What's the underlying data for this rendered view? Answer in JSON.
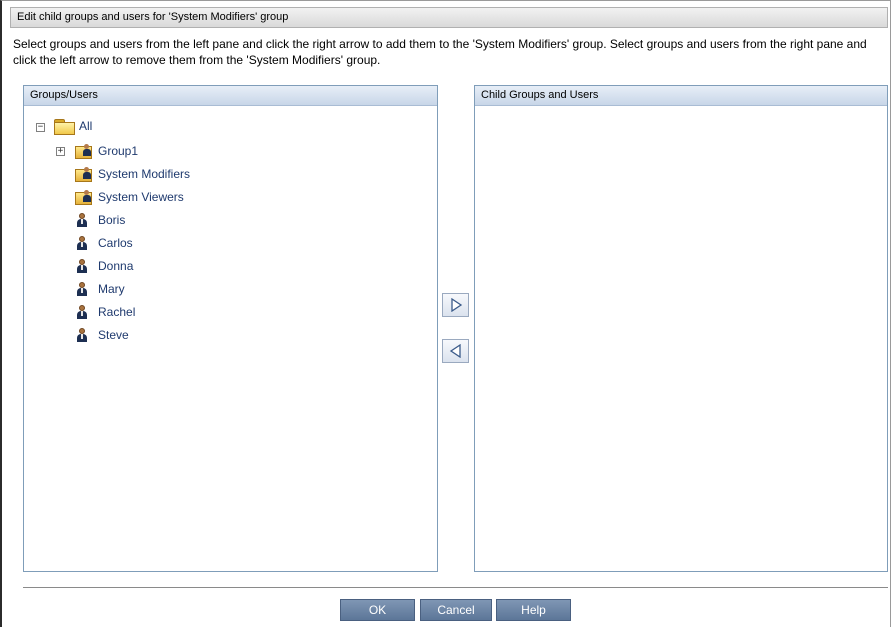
{
  "dialog": {
    "title": "Edit child groups and users for 'System Modifiers' group",
    "instructions": "Select groups and users from the left pane and click the right arrow to add them to the 'System Modifiers' group. Select groups and users from the right pane and click the left arrow to remove them from the 'System Modifiers' group."
  },
  "left_pane": {
    "header": "Groups/Users",
    "tree": {
      "root": {
        "label": "All",
        "expander": "−",
        "icon": "folder-icon"
      },
      "groups": [
        {
          "label": "Group1",
          "expander": "+",
          "icon": "group-folder-icon"
        },
        {
          "label": "System Modifiers",
          "icon": "group-folder-icon"
        },
        {
          "label": "System Viewers",
          "icon": "group-folder-icon"
        }
      ],
      "users": [
        {
          "label": "Boris",
          "icon": "user-icon"
        },
        {
          "label": "Carlos",
          "icon": "user-icon"
        },
        {
          "label": "Donna",
          "icon": "user-icon"
        },
        {
          "label": "Mary",
          "icon": "user-icon"
        },
        {
          "label": "Rachel",
          "icon": "user-icon"
        },
        {
          "label": "Steve",
          "icon": "user-icon"
        }
      ]
    }
  },
  "right_pane": {
    "header": "Child Groups and Users",
    "items": []
  },
  "transfer_buttons": {
    "add_icon": "right-arrow-icon",
    "remove_icon": "left-arrow-icon"
  },
  "footer": {
    "ok_label": "OK",
    "cancel_label": "Cancel",
    "help_label": "Help"
  },
  "colors": {
    "tree_text": "#1f3a6e",
    "button_bg": "#6b84a6",
    "pane_border": "#7f9db9"
  }
}
